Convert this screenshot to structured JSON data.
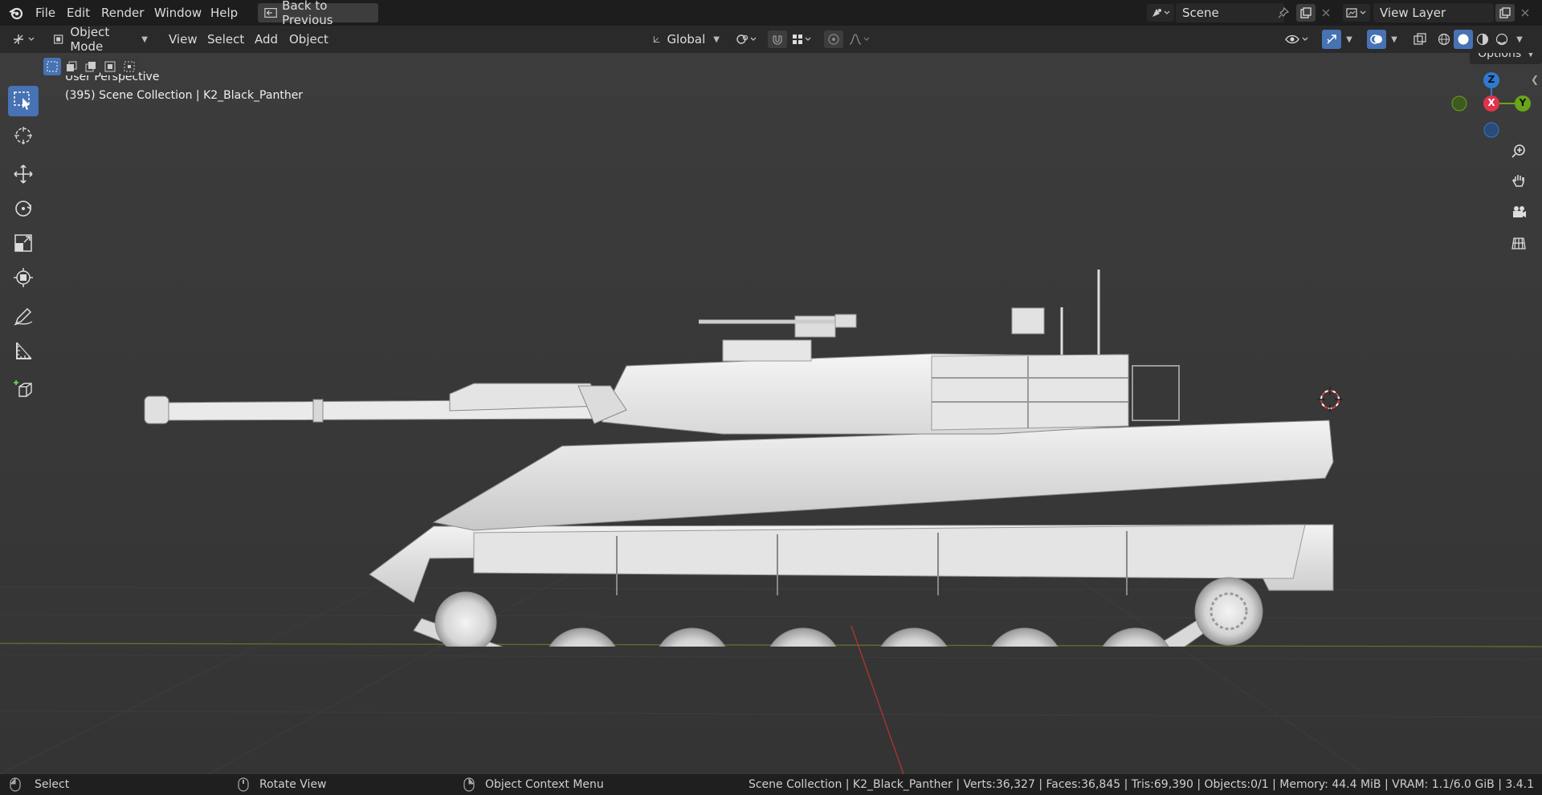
{
  "menubar": {
    "items": [
      "File",
      "Edit",
      "Render",
      "Window",
      "Help"
    ],
    "back_button": "Back to Previous",
    "scene_label": "Scene",
    "view_layer_label": "View Layer"
  },
  "header": {
    "mode": "Object Mode",
    "menus": [
      "View",
      "Select",
      "Add",
      "Object"
    ],
    "orientation": "Global",
    "options": "Options"
  },
  "viewport": {
    "perspective": "User Perspective",
    "collection_info": "(395) Scene Collection | K2_Black_Panther",
    "gizmo": {
      "z": "Z",
      "x": "X",
      "y": "Y"
    }
  },
  "statusbar": {
    "select": "Select",
    "rotate": "Rotate View",
    "context": "Object Context Menu",
    "stats": "Scene Collection | K2_Black_Panther | Verts:36,327 | Faces:36,845 | Tris:69,390 | Objects:0/1 | Memory: 44.4 MiB | VRAM: 1.1/6.0 GiB | 3.4.1"
  },
  "colors": {
    "accent": "#4772b3",
    "x_axis": "#e0334a",
    "y_axis": "#6aa51a",
    "z_axis": "#2f7ad1"
  }
}
